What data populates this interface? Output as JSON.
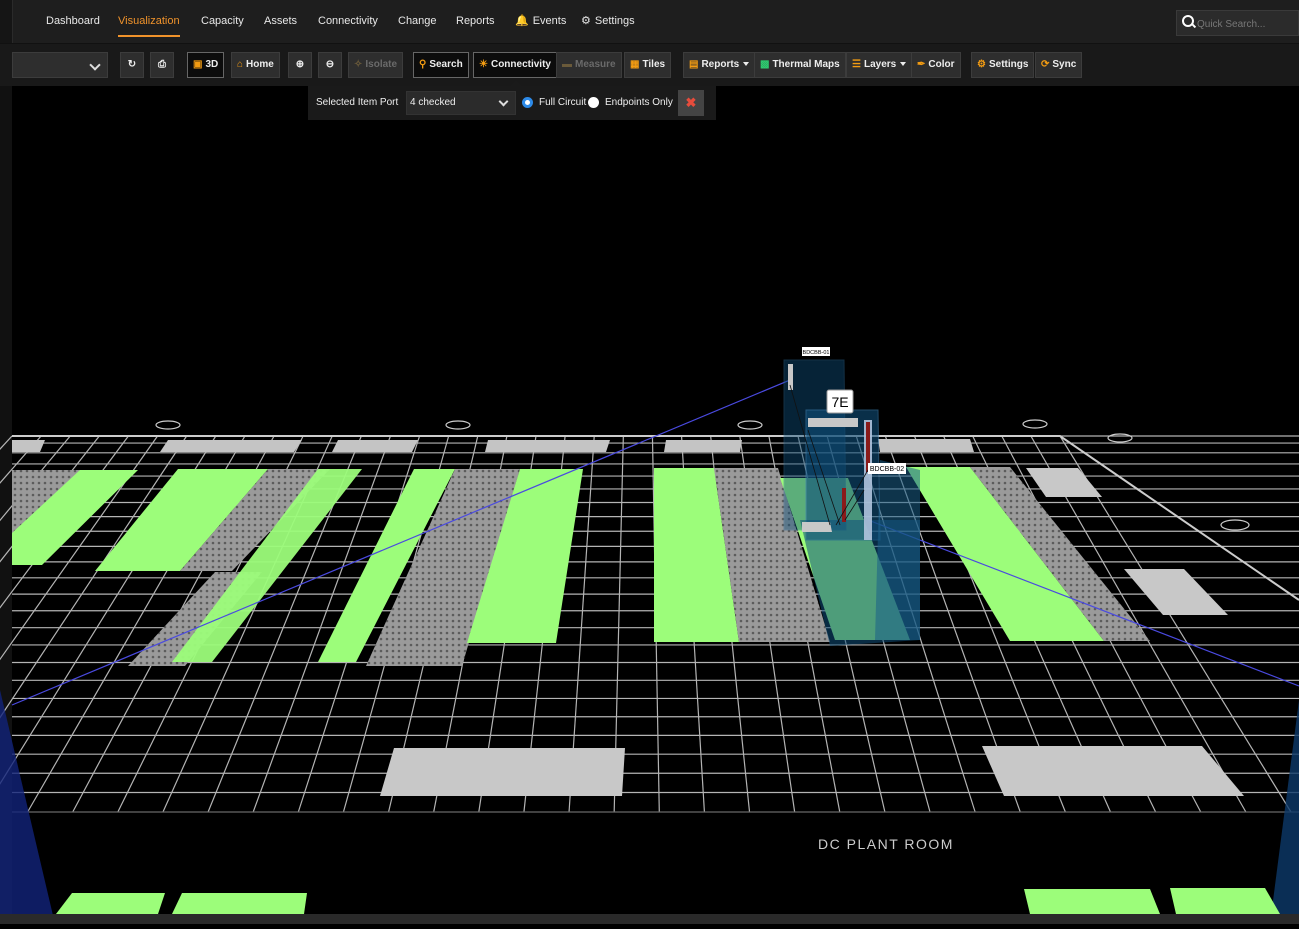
{
  "nav": {
    "items": [
      {
        "label": "Dashboard"
      },
      {
        "label": "Visualization"
      },
      {
        "label": "Capacity"
      },
      {
        "label": "Assets"
      },
      {
        "label": "Connectivity"
      },
      {
        "label": "Change"
      },
      {
        "label": "Reports"
      },
      {
        "label": "Events"
      },
      {
        "label": "Settings"
      }
    ],
    "search_placeholder": "Quick Search..."
  },
  "toolbar": {
    "buttons": [
      {
        "label": "3D"
      },
      {
        "label": "Home"
      },
      {
        "label": "Isolate"
      },
      {
        "label": "Search"
      },
      {
        "label": "Connectivity"
      },
      {
        "label": "Measure"
      },
      {
        "label": "Tiles"
      },
      {
        "label": "Reports"
      },
      {
        "label": "Thermal Maps"
      },
      {
        "label": "Layers"
      },
      {
        "label": "Color"
      },
      {
        "label": "Settings"
      },
      {
        "label": "Sync"
      }
    ]
  },
  "connectivity_panel": {
    "label": "Selected Item Port",
    "selected": "4 checked",
    "option_full": "Full Circuit",
    "option_endpoints": "Endpoints Only"
  },
  "scene": {
    "rack_top_label": "BDCBB-01",
    "rack_label": "7E",
    "rack_side_label": "BDCBB-02",
    "room_label": "DC PLANT ROOM"
  },
  "colors": {
    "tile_green": "#9cfd7a",
    "tile_gray": "#bcbcbc",
    "accent": "#f0932b",
    "rack_blue": "#0f4f7a"
  }
}
